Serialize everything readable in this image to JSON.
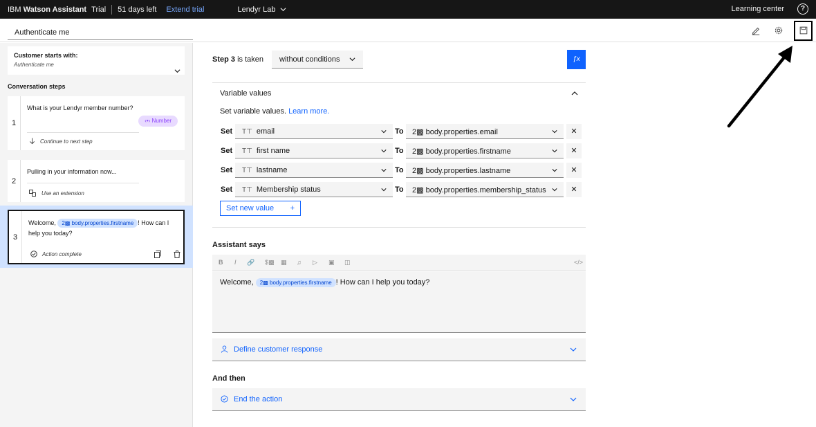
{
  "topbar": {
    "brand_ibm": "IBM",
    "brand_name": "Watson Assistant",
    "brand_plan": "Trial",
    "days_left": "51 days left",
    "extend_trial": "Extend trial",
    "workspace": "Lendyr Lab",
    "learning_center": "Learning center",
    "help_glyph": "?"
  },
  "header": {
    "action_name": "Authenticate me"
  },
  "sidebar": {
    "customer_starts_label": "Customer starts with:",
    "customer_starts_value": "Authenticate me",
    "conversation_steps_label": "Conversation steps",
    "steps": [
      {
        "number": "1",
        "text": "What is your Lendyr member number?",
        "badge": "Number",
        "footer": "Continue to next step"
      },
      {
        "number": "2",
        "text": "Pulling in your information now...",
        "footer": "Use an extension"
      },
      {
        "number": "3",
        "text_before": "Welcome,",
        "variable": "body.properties.firstname",
        "text_after": "! How can I",
        "text_line2": "help you today?",
        "footer": "Action complete"
      }
    ]
  },
  "main": {
    "step_label": "Step 3",
    "step_suffix": "is taken",
    "condition": "without conditions",
    "fx_label": "ƒx",
    "variable_values": {
      "title": "Variable values",
      "description": "Set variable values.",
      "learn_more": "Learn more.",
      "set_keyword": "Set",
      "to_keyword": "To",
      "rows": [
        {
          "variable": "email",
          "value": "body.properties.email"
        },
        {
          "variable": "first name",
          "value": "body.properties.firstname"
        },
        {
          "variable": "lastname",
          "value": "body.properties.lastname"
        },
        {
          "variable": "Membership status",
          "value": "body.properties.membership_status"
        }
      ],
      "new_value_button": "Set new value",
      "new_value_plus": "+"
    },
    "assistant_says": {
      "label": "Assistant says",
      "text_before": "Welcome,",
      "variable": "body.properties.firstname",
      "text_after": "! How can I help you today?"
    },
    "define_customer_response": "Define customer response",
    "and_then_label": "And then",
    "end_action": "End the action"
  },
  "colors": {
    "accent": "#0f62fe",
    "topbar": "#161616",
    "selected_step": "#d0e2ff",
    "number_badge": "#e8daff"
  }
}
